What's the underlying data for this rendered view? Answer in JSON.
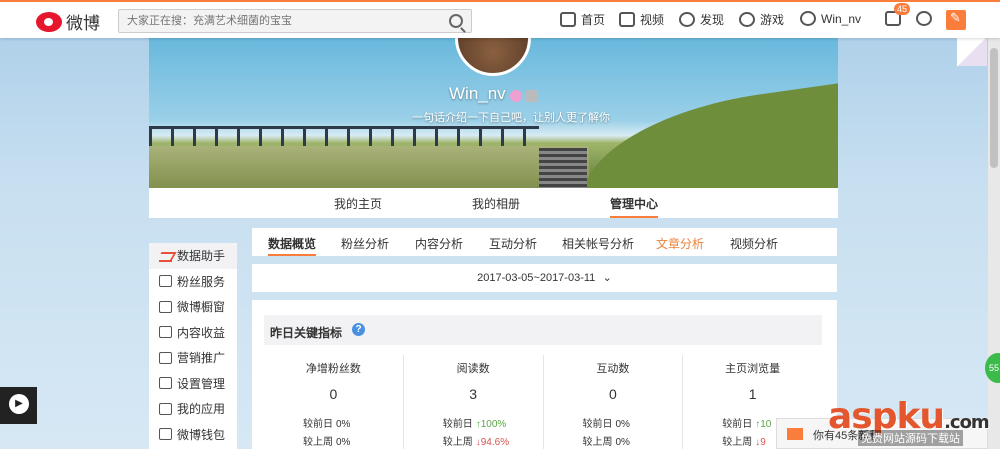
{
  "nav": {
    "logo_text": "微博",
    "search_placeholder": "大家正在搜：充满艺术细菌的宝宝",
    "items": [
      "首页",
      "视频",
      "发现",
      "游戏",
      "Win_nv"
    ],
    "badge_count": "45"
  },
  "profile": {
    "username": "Win_nv",
    "tagline": "一句话介绍一下自己吧，让别人更了解你",
    "tabs": [
      "我的主页",
      "我的相册",
      "管理中心"
    ]
  },
  "sidebar": {
    "items": [
      "数据助手",
      "粉丝服务",
      "微博橱窗",
      "内容收益",
      "营销推广",
      "设置管理",
      "我的应用",
      "微博钱包"
    ]
  },
  "analysis_tabs": [
    "数据概览",
    "粉丝分析",
    "内容分析",
    "互动分析",
    "相关帐号分析",
    "文章分析",
    "视频分析"
  ],
  "date_range": "2017-03-05~2017-03-11",
  "summary": {
    "title": "昨日关键指标",
    "help_icon": "?",
    "metrics": [
      {
        "name": "净增粉丝数",
        "value": "0",
        "day_label": "较前日",
        "day_value": "0%",
        "week_label": "较上周",
        "week_value": "0%"
      },
      {
        "name": "阅读数",
        "value": "3",
        "day_label": "较前日",
        "day_value": "↑100%",
        "week_label": "较上周",
        "week_value": "↓94.6%"
      },
      {
        "name": "互动数",
        "value": "0",
        "day_label": "较前日",
        "day_value": "0%",
        "week_label": "较上周",
        "week_value": "0%"
      },
      {
        "name": "主页浏览量",
        "value": "1",
        "day_label": "较前日",
        "day_value": "↑10",
        "week_label": "较上周",
        "week_value": "↓9"
      }
    ]
  },
  "popup": {
    "text": "你有45条新私"
  },
  "bubble": {
    "text": "55"
  },
  "watermark": {
    "main": "aspku",
    "suffix": ".com",
    "sub": "免费网站源码下载站"
  },
  "colors": {
    "accent": "#fa7d3c",
    "up": "#5aa744",
    "down": "#d9534f"
  }
}
